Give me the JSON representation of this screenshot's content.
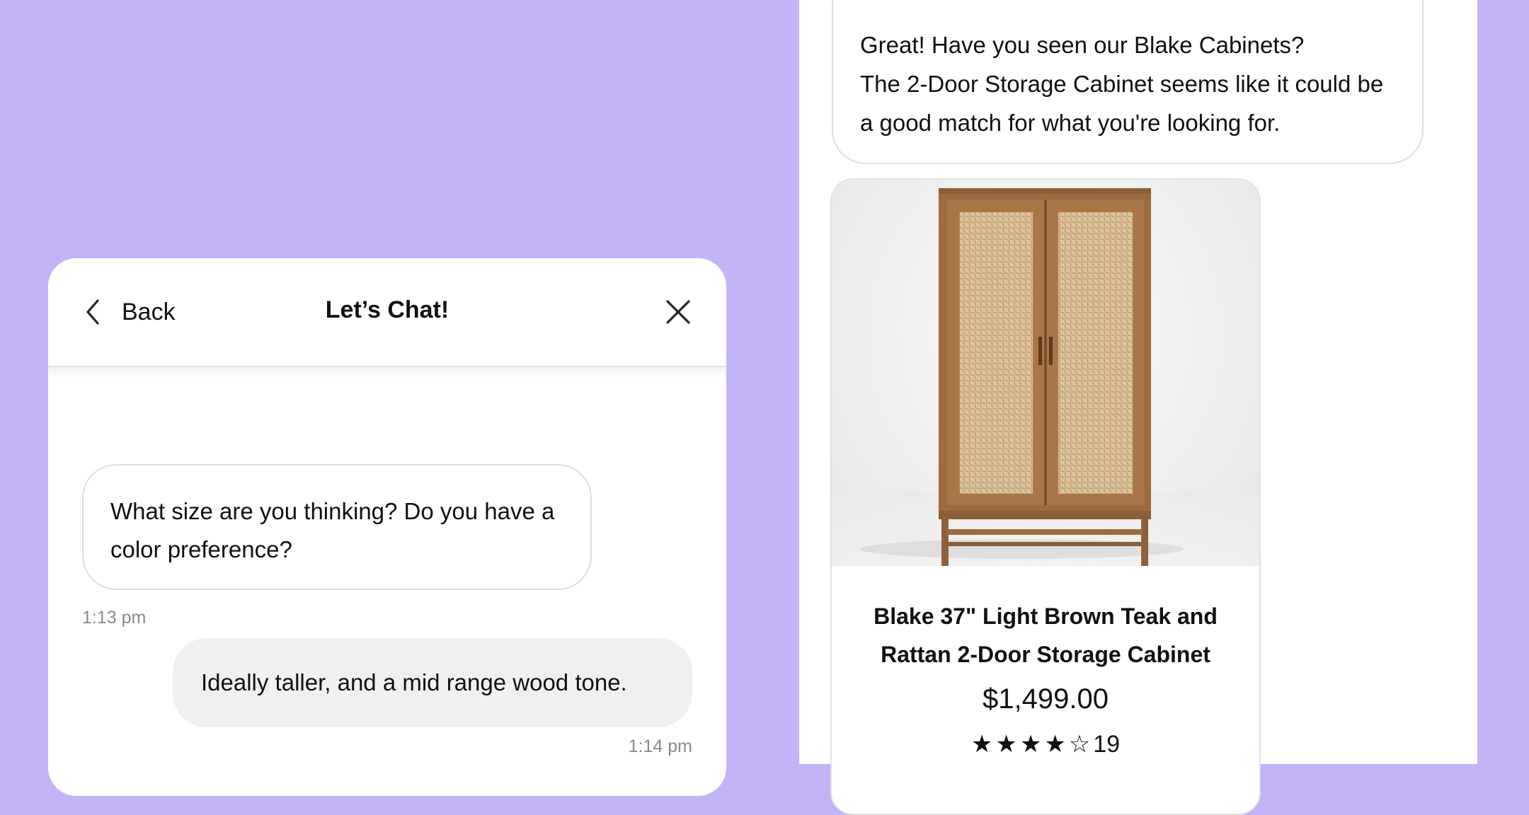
{
  "left_chat": {
    "header": {
      "back_label": "Back",
      "title": "Let’s Chat!"
    },
    "messages": [
      {
        "sender": "agent",
        "text": "What size are you thinking? Do you have a color preference?",
        "time": "1:13 pm"
      },
      {
        "sender": "user",
        "text": "Ideally taller, and a mid range wood tone.",
        "time": "1:14 pm"
      }
    ]
  },
  "right_chat": {
    "message": {
      "sender": "agent",
      "line1": "Great! Have you seen our Blake Cabinets?",
      "line2": "The 2-Door Storage Cabinet seems like it could be a good match for what you're looking for."
    },
    "product": {
      "name": "Blake 37\" Light Brown Teak and Rattan 2-Door Storage Cabinet",
      "price": "$1,499.00",
      "rating_stars": "★★★★☆",
      "rating": 4,
      "rating_max": 5,
      "review_count": "19"
    }
  },
  "colors": {
    "background": "#c2b4f6",
    "panel": "#ffffff",
    "user_bubble": "#f0f0f0",
    "timestamp": "#8a8a8a"
  },
  "icons": [
    "chevron-left-icon",
    "close-icon",
    "star-icon"
  ]
}
